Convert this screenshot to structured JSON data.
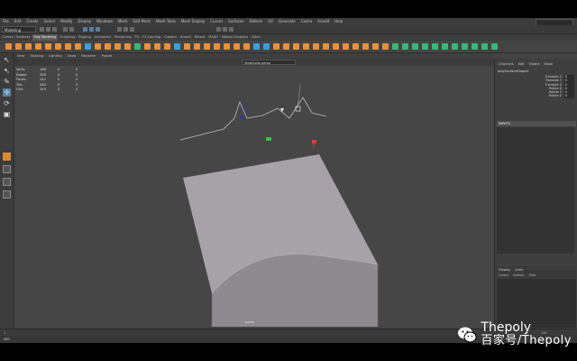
{
  "menus": [
    "File",
    "Edit",
    "Create",
    "Select",
    "Modify",
    "Display",
    "Windows",
    "Mesh",
    "Edit Mesh",
    "Mesh Tools",
    "Mesh Display",
    "Curves",
    "Surfaces",
    "Deform",
    "UV",
    "Generate",
    "Cache",
    "Arnold",
    "Help"
  ],
  "status": {
    "mode": "Modeling"
  },
  "shelf_tabs": [
    "Curves / Surfaces",
    "Poly Modeling",
    "Sculpting",
    "Rigging",
    "Animation",
    "Rendering",
    "FX",
    "FX Caching",
    "Custom",
    "Arnold",
    "Bifrost",
    "MASH",
    "Motion Graphics",
    "XGen"
  ],
  "shelf_active_index": 1,
  "viewport": {
    "menu": [
      "View",
      "Shading",
      "Lighting",
      "Show",
      "Renderer",
      "Panels"
    ],
    "camera": "ViewCube persp",
    "label": "persp",
    "hud_rows": [
      [
        "Verts:",
        "168",
        "0",
        "0"
      ],
      [
        "Edges:",
        "308",
        "0",
        "0"
      ],
      [
        "Faces:",
        "142",
        "0",
        "0"
      ],
      [
        "Tris:",
        "284",
        "0",
        "0"
      ],
      [
        "UVs:",
        "193",
        "0",
        "0"
      ]
    ]
  },
  "attr_editor": {
    "tabs": [
      "Channels",
      "Edit",
      "Object",
      "Show"
    ],
    "node": "polySurfaceShape1",
    "attrs": [
      [
        "Translate X",
        "0"
      ],
      [
        "Translate Y",
        "0"
      ],
      [
        "Translate Z",
        "0"
      ],
      [
        "Rotate X",
        "0"
      ],
      [
        "Rotate Y",
        "0"
      ],
      [
        "Rotate Z",
        "0"
      ]
    ],
    "section": "INPUTS"
  },
  "layer_panel": {
    "tabs": [
      "Display",
      "Anim"
    ],
    "menu": [
      "Layers",
      "Options",
      "Help"
    ]
  },
  "time_slider": {
    "start": "1",
    "end": "120",
    "mel_label": "MEL"
  },
  "watermark": {
    "brand": "Thepoly",
    "sub": "百家号/Thepoly"
  },
  "colors": {
    "accent_orange": "#e8903a",
    "accent_blue": "#3aa0d8",
    "accent_green": "#38b878",
    "maya_logo": "#2fb7c8",
    "viewport_bg": "#464646"
  }
}
